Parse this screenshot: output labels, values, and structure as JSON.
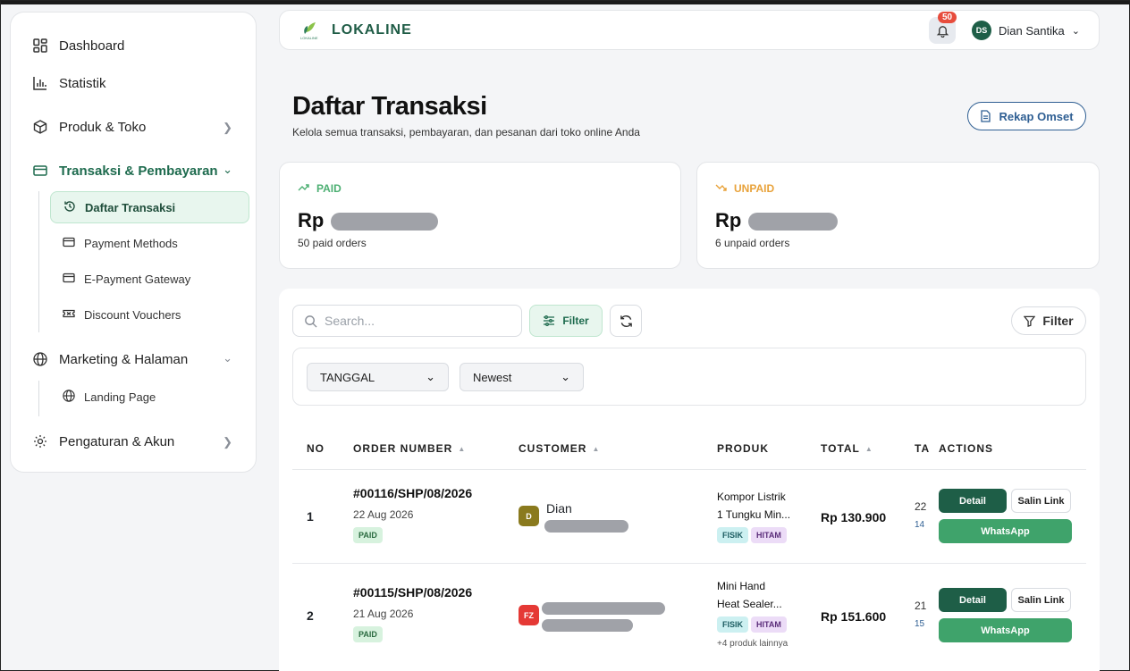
{
  "sidebar": {
    "items": [
      {
        "label": "Dashboard"
      },
      {
        "label": "Statistik"
      },
      {
        "label": "Produk & Toko"
      },
      {
        "label": "Transaksi & Pembayaran"
      },
      {
        "label": "Marketing & Halaman"
      },
      {
        "label": "Pengaturan & Akun"
      }
    ],
    "transaksi_sub": [
      {
        "label": "Daftar Transaksi"
      },
      {
        "label": "Payment Methods"
      },
      {
        "label": "E-Payment Gateway"
      },
      {
        "label": "Discount Vouchers"
      }
    ],
    "marketing_sub": [
      {
        "label": "Landing Page"
      }
    ]
  },
  "header": {
    "brand": "LOKALINE",
    "logo_text": "LOKALINE",
    "notif_count": "50",
    "user_initials": "DS",
    "user_name": "Dian Santika"
  },
  "page": {
    "title": "Daftar Transaksi",
    "subtitle": "Kelola semua transaksi, pembayaran, dan pesanan dari toko online Anda",
    "rekap_label": "Rekap Omset"
  },
  "stats": {
    "paid": {
      "label": "PAID",
      "currency": "Rp",
      "count_text": "50 paid orders",
      "color": "#4caf72"
    },
    "unpaid": {
      "label": "UNPAID",
      "currency": "Rp",
      "count_text": "6 unpaid orders",
      "color": "#e8a23a"
    }
  },
  "toolbar": {
    "search_placeholder": "Search...",
    "filter_label": "Filter",
    "filter_right_label": "Filter",
    "date_select": "TANGGAL",
    "sort_select": "Newest"
  },
  "table": {
    "headers": {
      "no": "NO",
      "order": "ORDER NUMBER",
      "customer": "CUSTOMER",
      "produk": "PRODUK",
      "total": "TOTAL",
      "tanggal": "TA",
      "actions": "ACTIONS"
    },
    "rows": [
      {
        "no": "1",
        "order": "#00116/SHP/08/2026",
        "date": "22 Aug 2026",
        "status": "PAID",
        "cust_initial": "D",
        "cust_name": "Dian",
        "cust_color": "#8a7a1e",
        "produk_line1": "Kompor Listrik",
        "produk_line2": "1 Tungku Min...",
        "tag1": "FISIK",
        "tag2": "HITAM",
        "more": "",
        "total": "Rp 130.900",
        "tcut1": "22",
        "tcut2": "14",
        "detail": "Detail",
        "salin": "Salin Link",
        "wa": "WhatsApp"
      },
      {
        "no": "2",
        "order": "#00115/SHP/08/2026",
        "date": "21 Aug 2026",
        "status": "PAID",
        "cust_initial": "FZ",
        "cust_name": "",
        "cust_color": "#e53935",
        "produk_line1": "Mini Hand",
        "produk_line2": "Heat Sealer...",
        "tag1": "FISIK",
        "tag2": "HITAM",
        "more": "+4 produk lainnya",
        "total": "Rp 151.600",
        "tcut1": "21",
        "tcut2": "15",
        "detail": "Detail",
        "salin": "Salin Link",
        "wa": "WhatsApp"
      }
    ]
  }
}
